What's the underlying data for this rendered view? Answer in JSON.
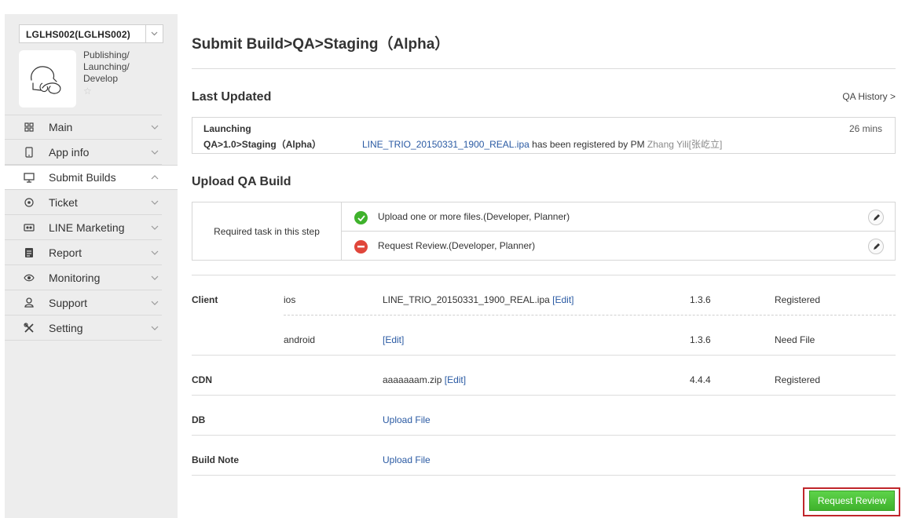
{
  "sidebar": {
    "app_selector": {
      "value": "LGLHS002(LGLHS002)"
    },
    "app_category": [
      "Publishing/",
      "Launching/",
      "Develop"
    ],
    "star_glyph": "☆",
    "items": [
      {
        "label": "Main",
        "icon": "grid-icon",
        "chevron": "down"
      },
      {
        "label": "App info",
        "icon": "phone-icon",
        "chevron": "down"
      },
      {
        "label": "Submit Builds",
        "icon": "monitor-icon",
        "chevron": "up",
        "active": true
      },
      {
        "label": "Ticket",
        "icon": "compass-icon",
        "chevron": "down"
      },
      {
        "label": "LINE Marketing",
        "icon": "ticket-icon",
        "chevron": "down"
      },
      {
        "label": "Report",
        "icon": "report-icon",
        "chevron": "down"
      },
      {
        "label": "Monitoring",
        "icon": "eye-icon",
        "chevron": "down"
      },
      {
        "label": "Support",
        "icon": "person-icon",
        "chevron": "down"
      },
      {
        "label": "Setting",
        "icon": "tools-icon",
        "chevron": "down"
      }
    ]
  },
  "main": {
    "title": "Submit Build>QA>Staging（Alpha）",
    "last_updated": {
      "heading": "Last Updated",
      "history_link": "QA History >",
      "line1": "Launching",
      "line2": "QA>1.0>Staging（Alpha）",
      "file_link": "LINE_TRIO_20150331_1900_REAL.ipa",
      "message": " has been registered by PM ",
      "pm_name": "Zhang Yili[张屹立]",
      "time": "26 mins"
    },
    "upload": {
      "heading": "Upload QA Build",
      "required_label": "Required task in this step",
      "tasks": [
        {
          "text": "Upload one or more files.(Developer, Planner)",
          "status": "done"
        },
        {
          "text": "Request Review.(Developer, Planner)",
          "status": "blocked"
        }
      ]
    },
    "builds": {
      "client_label": "Client",
      "ios": {
        "platform": "ios",
        "file": "LINE_TRIO_20150331_1900_REAL.ipa",
        "edit": "[Edit]",
        "version": "1.3.6",
        "status": "Registered"
      },
      "android": {
        "platform": "android",
        "edit": "[Edit]",
        "version": "1.3.6",
        "status": "Need File"
      },
      "cdn": {
        "label": "CDN",
        "file": "aaaaaaam.zip",
        "edit": "[Edit]",
        "version": "4.4.4",
        "status": "Registered"
      },
      "db": {
        "label": "DB",
        "action": "Upload File"
      },
      "build_note": {
        "label": "Build Note",
        "action": "Upload File"
      }
    },
    "request_review": "Request Review"
  },
  "colors": {
    "link": "#2a5aa3",
    "success": "#3fb22c",
    "danger": "#e0463b",
    "highlight_border": "#c0262b"
  }
}
